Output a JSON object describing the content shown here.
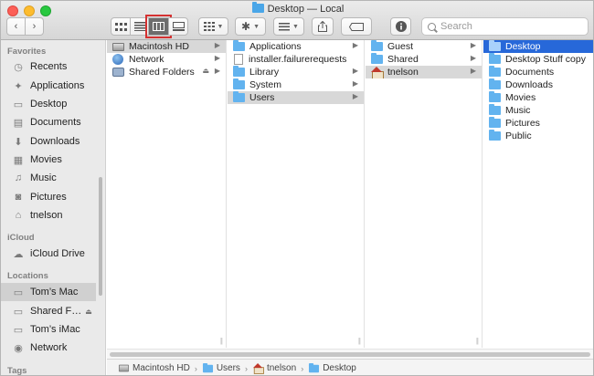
{
  "window": {
    "title": "Desktop — Local"
  },
  "toolbar": {
    "back_label": "‹",
    "forward_label": "›",
    "search_placeholder": "Search",
    "view_icons": [
      "icon-view-icon",
      "list-view-icon",
      "column-view-icon",
      "gallery-view-icon"
    ],
    "selected_view": "column-view"
  },
  "sidebar": {
    "favorites_header": "Favorites",
    "favorites": [
      {
        "label": "Recents",
        "icon": "recents-icon",
        "glyph": "◷"
      },
      {
        "label": "Applications",
        "icon": "applications-icon",
        "glyph": "✦"
      },
      {
        "label": "Desktop",
        "icon": "desktop-icon",
        "glyph": "▭"
      },
      {
        "label": "Documents",
        "icon": "documents-icon",
        "glyph": "▤"
      },
      {
        "label": "Downloads",
        "icon": "downloads-icon",
        "glyph": "⬇"
      },
      {
        "label": "Movies",
        "icon": "movies-icon",
        "glyph": "▦"
      },
      {
        "label": "Music",
        "icon": "music-icon",
        "glyph": "♫"
      },
      {
        "label": "Pictures",
        "icon": "pictures-icon",
        "glyph": "◙"
      },
      {
        "label": "tnelson",
        "icon": "home-icon",
        "glyph": "⌂"
      }
    ],
    "icloud_header": "iCloud",
    "icloud": [
      {
        "label": "iCloud Drive",
        "icon": "cloud-icon",
        "glyph": "☁"
      }
    ],
    "locations_header": "Locations",
    "locations": [
      {
        "label": "Tom’s Mac",
        "icon": "computer-icon",
        "glyph": "▭"
      },
      {
        "label": "Shared F…",
        "icon": "computer-icon",
        "glyph": "▭"
      },
      {
        "label": "Tom’s iMac",
        "icon": "computer-icon",
        "glyph": "▭"
      },
      {
        "label": "Network",
        "icon": "network-icon",
        "glyph": "◉"
      }
    ],
    "tags_header": "Tags"
  },
  "columns": {
    "col1": [
      "Macintosh HD",
      "Network",
      "Shared Folders"
    ],
    "col2": [
      "Applications",
      "installer.failurerequests",
      "Library",
      "System",
      "Users"
    ],
    "col3": [
      "Guest",
      "Shared",
      "tnelson"
    ],
    "col4": [
      "Desktop",
      "Desktop Stuff copy",
      "Documents",
      "Downloads",
      "Movies",
      "Music",
      "Pictures",
      "Public"
    ]
  },
  "pathbar": [
    "Macintosh HD",
    "Users",
    "tnelson",
    "Desktop"
  ],
  "colors": {
    "selection_blue": "#2768d9",
    "folder_blue": "#62b3ef",
    "highlight_red": "#d43131"
  }
}
